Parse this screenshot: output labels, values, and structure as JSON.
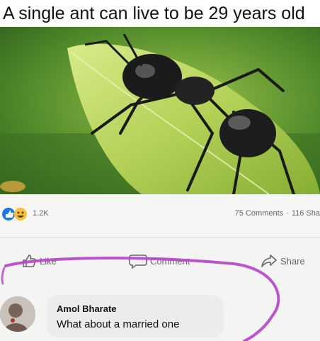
{
  "caption": "A single ant can live to be 29 years old",
  "post": {
    "reaction_count": "1.2K",
    "comments_count": "75 Comments",
    "separator": "·",
    "shares_count": "116 Sha"
  },
  "actions": {
    "like": "Like",
    "comment": "Comment",
    "share": "Share"
  },
  "comment": {
    "author": "Amol Bharate",
    "text": "What about a married one"
  },
  "colors": {
    "like_blue": "#1877f2",
    "haha_yellow": "#f7c238",
    "marker_purple": "#b543c9",
    "leaf_green": "#a9c94a"
  },
  "icons": [
    "like-reaction-icon",
    "haha-reaction-icon",
    "like-icon",
    "comment-icon",
    "share-icon"
  ]
}
